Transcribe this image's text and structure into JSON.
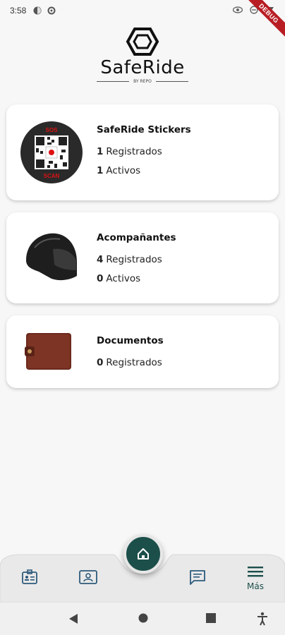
{
  "status_bar": {
    "time": "3:58",
    "left_icons": [
      "photo-icon",
      "settings-icon"
    ],
    "right_icons": [
      "eye-icon",
      "minus-circle-icon",
      "signal-icon"
    ]
  },
  "debug_banner": "DEBUG",
  "logo": {
    "brand": "SafeRide",
    "byline": "BY REPO"
  },
  "cards": [
    {
      "title": "SafeRide Stickers",
      "rows": [
        {
          "count": "1",
          "label": "Registrados"
        },
        {
          "count": "1",
          "label": "Activos"
        }
      ],
      "thumb_icon": "qr-sticker-icon",
      "sticker_top_text": "SOS",
      "sticker_bottom_text": "SCAN"
    },
    {
      "title": "Acompañantes",
      "rows": [
        {
          "count": "4",
          "label": "Registrados"
        },
        {
          "count": "0",
          "label": "Activos"
        }
      ],
      "thumb_icon": "helmet-icon"
    },
    {
      "title": "Documentos",
      "rows": [
        {
          "count": "0",
          "label": "Registrados"
        }
      ],
      "thumb_icon": "wallet-icon"
    }
  ],
  "bottom_nav": {
    "items": [
      {
        "icon": "id-badge-icon",
        "label": ""
      },
      {
        "icon": "contact-card-icon",
        "label": ""
      },
      {
        "icon": "home-icon",
        "label": ""
      },
      {
        "icon": "chat-icon",
        "label": ""
      },
      {
        "icon": "menu-icon",
        "label": "Más"
      }
    ],
    "accent": "#1c4f4a",
    "icon_color": "#2d5a7b"
  },
  "system_nav": [
    "back-icon",
    "home-circle-icon",
    "recents-icon",
    "accessibility-icon"
  ]
}
